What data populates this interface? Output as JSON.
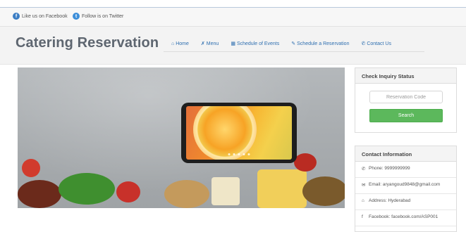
{
  "topbar": {
    "facebook_label": "Like us on Facebook",
    "twitter_label": "Follow is on Twitter"
  },
  "header": {
    "brand": "Catering Reservation",
    "nav": [
      {
        "label": "Home",
        "icon": "home-icon"
      },
      {
        "label": "Menu",
        "icon": "cutlery-icon"
      },
      {
        "label": "Schedule of Events",
        "icon": "calendar-icon"
      },
      {
        "label": "Schedule a Reservation",
        "icon": "pencil-icon"
      },
      {
        "label": "Contact Us",
        "icon": "phone-icon"
      }
    ]
  },
  "inquiry": {
    "title": "Check Inquiry Status",
    "placeholder": "Reservation Code",
    "button": "Search"
  },
  "contact": {
    "title": "Contact Information",
    "phone": "Phone: 9999999999",
    "email": "Email: aryangoud9848@gmail.com",
    "address": "Address: Hyderabad",
    "facebook": "Facebook: facebook.com/ASP001"
  },
  "colors": {
    "nav_link": "#2f6fb0",
    "search_button": "#5cb85c",
    "brand_text": "#5e6670"
  }
}
